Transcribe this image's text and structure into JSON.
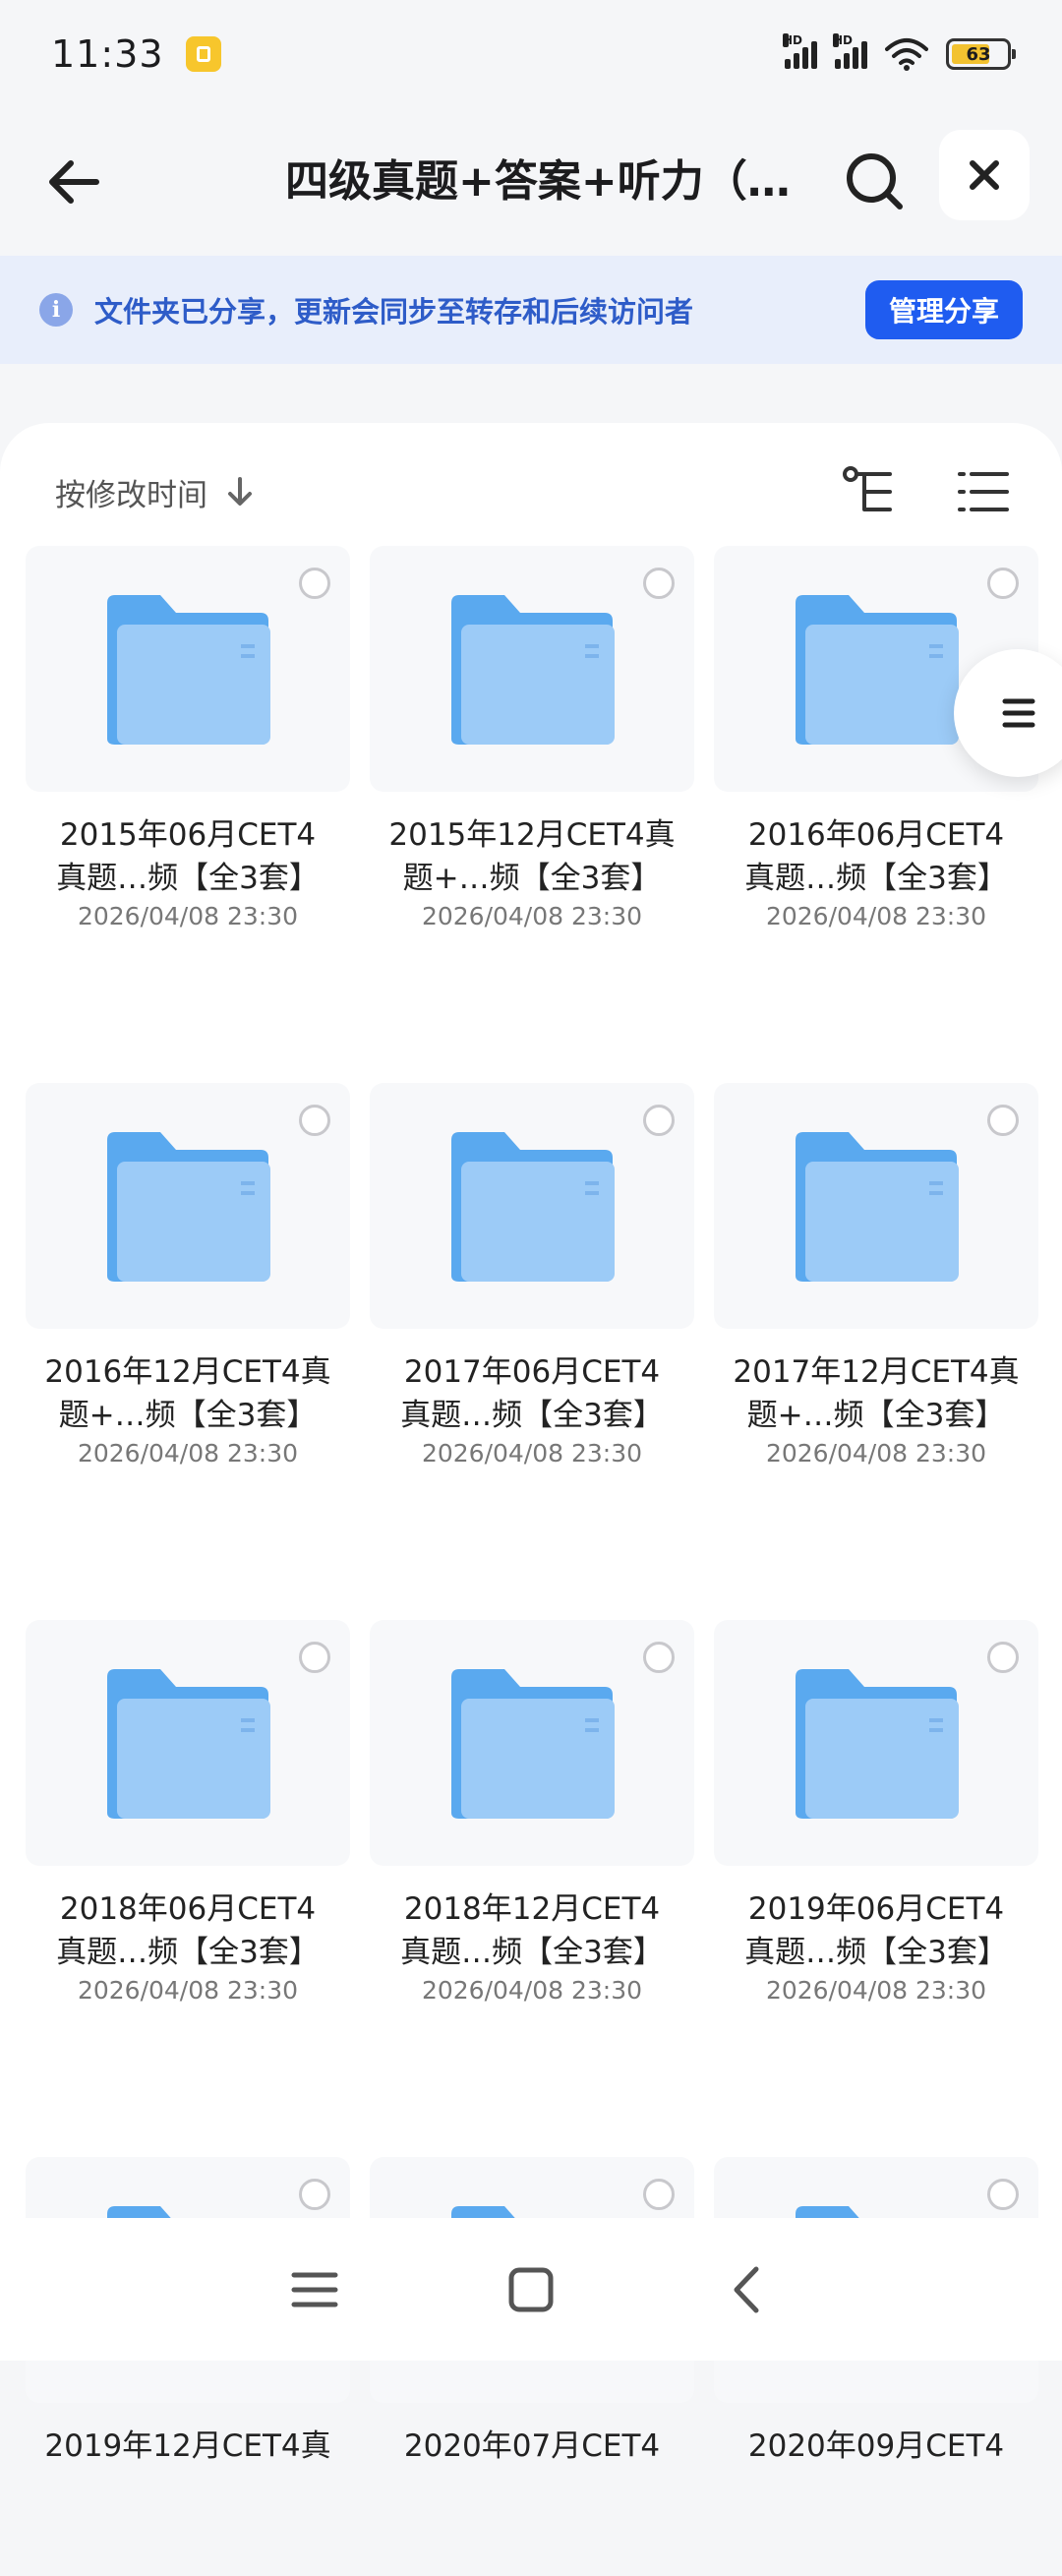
{
  "status_bar": {
    "time": "11:33",
    "signal_label": "HD",
    "battery_level": "63"
  },
  "header": {
    "title": "四级真题+答案+听力（…",
    "back_icon": "arrow-left-icon",
    "search_icon": "search-icon",
    "close_icon": "close-icon"
  },
  "banner": {
    "text": "文件夹已分享，更新会同步至转存和后续访问者",
    "button_label": "管理分享",
    "accent": "#1f5cf0"
  },
  "toolbar": {
    "sort_label": "按修改时间"
  },
  "folders": [
    {
      "name": "2015年06月CET4\n真题…频【全3套】",
      "date": "2026/04/08 23:30"
    },
    {
      "name": "2015年12月CET4真\n题+…频【全3套】",
      "date": "2026/04/08 23:30"
    },
    {
      "name": "2016年06月CET4\n真题…频【全3套】",
      "date": "2026/04/08 23:30"
    },
    {
      "name": "2016年12月CET4真\n题+…频【全3套】",
      "date": "2026/04/08 23:30"
    },
    {
      "name": "2017年06月CET4\n真题…频【全3套】",
      "date": "2026/04/08 23:30"
    },
    {
      "name": "2017年12月CET4真\n题+…频【全3套】",
      "date": "2026/04/08 23:30"
    },
    {
      "name": "2018年06月CET4\n真题…频【全3套】",
      "date": "2026/04/08 23:30"
    },
    {
      "name": "2018年12月CET4\n真题…频【全3套】",
      "date": "2026/04/08 23:30"
    },
    {
      "name": "2019年06月CET4\n真题…频【全3套】",
      "date": "2026/04/08 23:30"
    },
    {
      "name": "2019年12月CET4真",
      "date": ""
    },
    {
      "name": "2020年07月CET4",
      "date": ""
    },
    {
      "name": "2020年09月CET4",
      "date": ""
    }
  ],
  "nav": {
    "menu_icon": "menu-icon",
    "home_icon": "home-icon",
    "back_icon": "back-icon"
  }
}
